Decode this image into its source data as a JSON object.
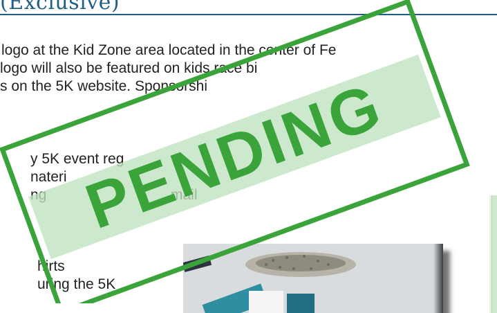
{
  "heading": {
    "text": "(Exclusive)"
  },
  "paragraph": {
    "lines": [
      "logo at the Kid Zone area located in the center of Fe",
      "logo will also be featured on kids race bi",
      "s on the 5K website. Sponsorshi"
    ]
  },
  "bullets": {
    "lines": [
      "y 5K event reg",
      "nateri",
      "ng",
      "mail"
    ]
  },
  "bullets2": {
    "lines": [
      "hirts",
      "uring the 5K"
    ]
  },
  "stamp": {
    "text": "PENDING",
    "color": "#3aa33a",
    "band_color": "#bfe3bf"
  }
}
